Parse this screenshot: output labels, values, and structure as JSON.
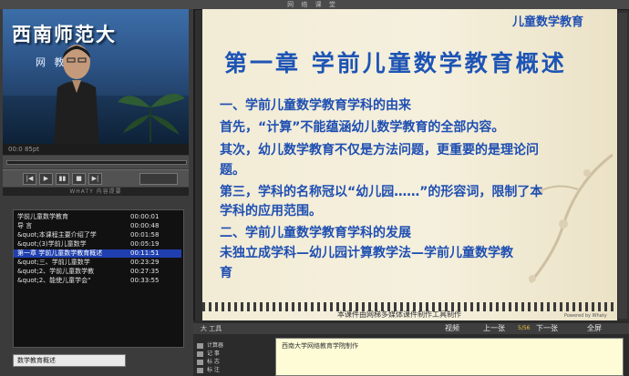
{
  "window": {
    "title": "网 络 课 堂"
  },
  "video": {
    "sign_text": "西南师范大",
    "sub_text": "网 教育学",
    "status": "00:0 85pt"
  },
  "controls": {
    "buttons": [
      "|◀",
      "▶",
      "▮▮",
      "■",
      "▶|"
    ],
    "list_title": "WHATY 内容提要"
  },
  "contents": {
    "items": [
      {
        "title": "学前儿童数学教育",
        "time": "00:00:01",
        "selected": false
      },
      {
        "title": "导 言",
        "time": "00:00:48",
        "selected": false
      },
      {
        "title": "&quot;本课程主要介绍了学",
        "time": "00:01:58",
        "selected": false
      },
      {
        "title": "&quot;(3)学前儿童数学",
        "time": "00:05:19",
        "selected": false
      },
      {
        "title": "第一章 学前儿童数学教育概述",
        "time": "00:11:51",
        "selected": true
      },
      {
        "title": "&quot;三、学前儿童数学",
        "time": "00:23:29",
        "selected": false
      },
      {
        "title": "&quot;2、学前儿童数学教",
        "time": "00:27:35",
        "selected": false
      },
      {
        "title": "&quot;2、能使儿童学会“",
        "time": "00:33:55",
        "selected": false
      }
    ],
    "bottom_field": "数学教育概述"
  },
  "slide": {
    "corner_label": "儿童数学教育",
    "title": "第一章  学前儿童数学教育概述",
    "lines": [
      "一、学前儿童数学教育学科的由来",
      "首先，“计算”不能蕴涵幼儿数学教育的全部内容。",
      "其次，幼儿数学教育不仅是方法问题，更重要的是理论问",
      "题。",
      "第三，学科的名称冠以“幼儿园……”的形容词，限制了本",
      "学科的应用范围。",
      "二、学前儿童数学教育学科的发展",
      "      未独立成学科—幼儿园计算教学法—学前儿童数学教",
      "育"
    ],
    "footer": "本课件由网梯多媒体课件制作工具制作",
    "powered": "Powered by Whaty"
  },
  "bottom_panel": {
    "header_label": "大 工具",
    "items": {
      "video": "视频",
      "prev": "上一张",
      "page": "5/56",
      "next": "下一张",
      "fullscreen": "全屏"
    },
    "side_buttons": [
      "计算器",
      "记 事",
      "标 志",
      "标 注"
    ],
    "note": "西南大学网络教育学院制作"
  },
  "colors": {
    "accent": "#1d54b5",
    "selected_row": "#1f3fb0"
  }
}
